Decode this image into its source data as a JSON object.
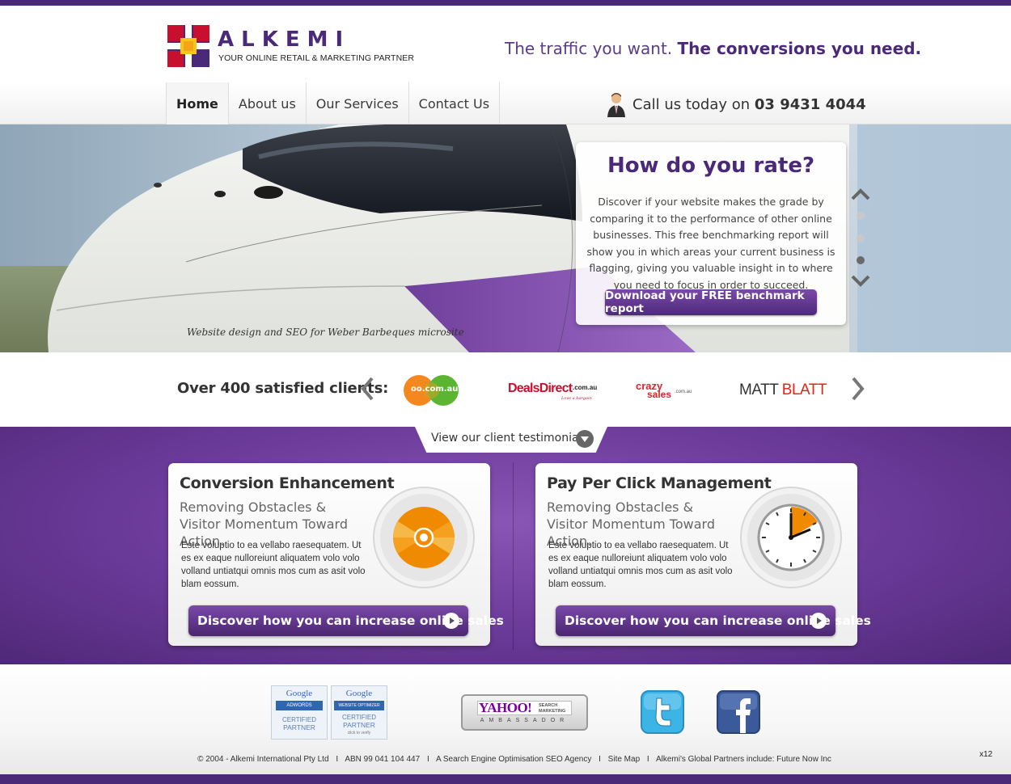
{
  "header": {
    "logo_name": "ALKEMI",
    "logo_tagline": "YOUR ONLINE RETAIL & MARKETING PARTNER",
    "tagline_regular": "The traffic you want.",
    "tagline_bold": "The conversions you need."
  },
  "nav": {
    "items": [
      {
        "label": "Home",
        "active": true
      },
      {
        "label": "About us"
      },
      {
        "label": "Our Services"
      },
      {
        "label": "Contact Us"
      }
    ],
    "phone_prefix": "Call us today on",
    "phone_number": "03 9431 4044"
  },
  "hero": {
    "caption": "Website design and SEO for Weber Barbeques microsite",
    "box_title": "How do you rate?",
    "box_body": "Discover if your website makes the grade by comparing it to the performance of other online businesses. This free benchmarking report will show you in which areas your current business is flagging, giving you valuable insight in to where you need to focus in order to succeed.",
    "box_button": "Download your FREE benchmark report",
    "slide_dots": 3,
    "active_dot": 3
  },
  "clients": {
    "label": "Over 400 satisfied clients:",
    "logos": [
      {
        "text": "oo.com.au"
      },
      {
        "text": "DealsDirect",
        "suffix": ".com.au",
        "sub": "Love a bargain"
      },
      {
        "text": "crazy",
        "text2": "sales",
        "suffix": ".com.au"
      },
      {
        "text": "MATT",
        "text2": "BLATT"
      }
    ]
  },
  "testimonials_tab": "View our client testimonials",
  "services": [
    {
      "title": "Conversion Enhancement",
      "subtitle": "Removing Obstacles & Visitor Momentum Toward Action.",
      "text": "Este voluptio to ea vellabo raesequatem. Ut es ex eaque nulloreiunt aliquatem volo volo volland untiatqui omnis mos cum as asit volo blam eossum.",
      "button": "Discover how you can increase online sales",
      "icon": "target-icon"
    },
    {
      "title": "Pay Per Click Management",
      "subtitle": "Removing Obstacles & Visitor Momentum Toward Action.",
      "text": "Este voluptio to ea vellabo raesequatem. Ut es ex eaque nulloreiunt aliquatem volo volo volland untiatqui omnis mos cum as asit volo blam eossum.",
      "button": "Discover how you can increase online sales",
      "icon": "clock-icon"
    }
  ],
  "footer": {
    "badges": {
      "adwords": {
        "brand": "Google",
        "product": "ADWORDS",
        "line1": "CERTIFIED",
        "line2": "PARTNER"
      },
      "optimizer": {
        "brand": "Google",
        "product": "WEBSITE OPTIMIZER",
        "line1": "CERTIFIED",
        "line2": "PARTNER",
        "line3": "click to verify"
      },
      "yahoo": {
        "brand": "YAHOO!",
        "product1": "SEARCH",
        "product2": "MARKETING",
        "line": "AMBASSADOR"
      }
    },
    "social": [
      "twitter-icon",
      "facebook-icon"
    ],
    "copyright": "© 2004 - Alkemi International Pty Ltd",
    "abn": "ABN 99 041 104 447",
    "seo": "A Search Engine Optimisation SEO Agency",
    "sitemap": "Site Map",
    "partners": "Alkemi's Global Partners include: Future Now Inc",
    "separator": "I"
  },
  "corner_label": "x12",
  "colors": {
    "brand_purple": "#4a2a78",
    "accent_orange": "#f08a00",
    "logo_red": "#c8102e",
    "logo_yellow": "#f5c518"
  }
}
